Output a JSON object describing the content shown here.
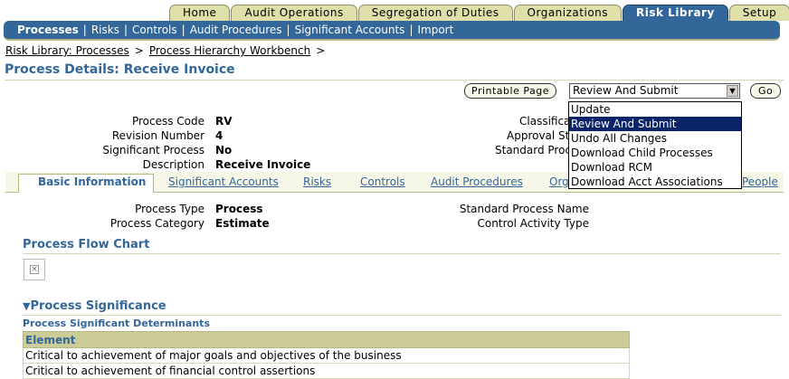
{
  "top_tabs": [
    "Home",
    "Audit Operations",
    "Segregation of Duties",
    "Organizations",
    "Risk Library",
    "Setup"
  ],
  "top_tab_active": "Risk Library",
  "subnav": {
    "items": [
      "Processes",
      "Risks",
      "Controls",
      "Audit Procedures",
      "Significant Accounts",
      "Import"
    ],
    "active": "Processes",
    "separator": "|"
  },
  "breadcrumb": {
    "items": [
      "Risk Library: Processes",
      "Process Hierarchy Workbench"
    ],
    "separator": ">"
  },
  "page_title": "Process Details: Receive Invoice",
  "actions": {
    "printable_page_label": "Printable Page",
    "select_value": "Review And Submit",
    "go_label": "Go",
    "options": [
      "Update",
      "Review And Submit",
      "Undo All Changes",
      "Download Child Processes",
      "Download RCM",
      "Download Acct Associations"
    ],
    "selected_index": 1
  },
  "header_fields": {
    "process_code_label": "Process Code",
    "process_code": "RV",
    "revision_number_label": "Revision Number",
    "revision_number": "4",
    "significant_process_label": "Significant Process",
    "significant_process": "No",
    "description_label": "Description",
    "description": "Receive Invoice",
    "classification_label": "Classifica",
    "approval_status_label": "Approval Sta",
    "standard_process_label": "Standard Proc"
  },
  "subtabs": {
    "active": "Basic Information",
    "items": [
      "Basic Information",
      "Significant Accounts",
      "Risks",
      "Controls",
      "Audit Procedures",
      "Org",
      "People"
    ]
  },
  "basic_info": {
    "process_type_label": "Process Type",
    "process_type": "Process",
    "process_category_label": "Process Category",
    "process_category": "Estimate",
    "standard_process_name_label": "Standard Process Name",
    "control_activity_type_label": "Control Activity Type"
  },
  "sections": {
    "flow_chart": "Process Flow Chart",
    "significance": "Process Significance",
    "significant_determinants": "Process Significant Determinants"
  },
  "determinants_table": {
    "header": "Element",
    "rows": [
      "Critical to achievement of major goals and objectives of the business",
      "Critical to achievement of financial control assertions"
    ]
  },
  "icons": {
    "collapse": "triangle-down-icon",
    "broken_image": "broken-image-icon",
    "dropdown": "chevron-down-icon"
  },
  "colors": {
    "brand_blue": "#336699",
    "tab_tan": "#dfdfa9",
    "table_header": "#cccc99",
    "selection": "#0a246a"
  }
}
